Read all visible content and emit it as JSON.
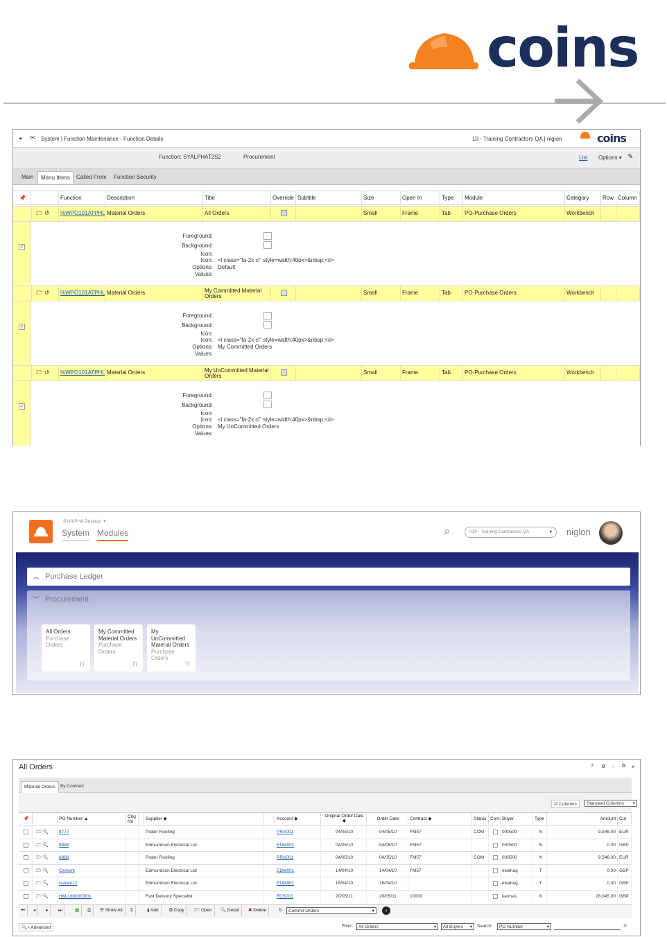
{
  "brand": {
    "name": "coins"
  },
  "p1": {
    "breadcrumb": "System | Function Maintenance - Function Details",
    "company": "10 - Training Contractors QA | niglon",
    "brand_small": "coins",
    "function_label": "Function: SYALPHAT2S2",
    "module_label": "Procurement",
    "list_link": "List",
    "options": "Options",
    "tabs": [
      "Main",
      "Menu Items",
      "Called From",
      "Function Security"
    ],
    "headers": [
      "Function",
      "Description",
      "Title",
      "Override",
      "Subtitle",
      "Size",
      "Open In",
      "Type",
      "Module",
      "Category",
      "Row",
      "Column"
    ],
    "rows": [
      {
        "function": "%WPO101ATPHL",
        "description": "Material Orders",
        "title": "All Orders",
        "size": "Small",
        "open_in": "Frame",
        "type": "Tab",
        "module": "PO-Purchase Orders",
        "category": "Workbench",
        "icon_line": "<i class=\"fa-2x cl\" style=width:40px>&nbsp;</i>",
        "options": "Default"
      },
      {
        "function": "%WPO101ATPHL",
        "description": "Material Orders",
        "title": "My Committed Material Orders",
        "size": "Small",
        "open_in": "Frame",
        "type": "Tab",
        "module": "PO-Purchase Orders",
        "category": "Workbench",
        "icon_line": "<i class=\"fa-2x cl\" style=width:40px>&nbsp;</i>",
        "options": "My Committed Orders"
      },
      {
        "function": "%WPO101ATPHL",
        "description": "Material Orders",
        "title": "My UnCommitted Material Orders",
        "size": "Small",
        "open_in": "Frame",
        "type": "Tab",
        "module": "PO-Purchase Orders",
        "category": "Workbench",
        "icon_line": "<i class=\"fa-2x cl\" style=width:40px>&nbsp;</i>",
        "options": "My UnCommitted Orders"
      }
    ],
    "detail_labels": [
      "Foreground:",
      "Background:",
      "Icon:",
      "Icon:",
      "Options:",
      "Values:"
    ]
  },
  "p2": {
    "desktop": "SYALPHA Desktop",
    "nav": [
      "System",
      "Modules"
    ],
    "company": "010 - Training Contractors QA",
    "user": "niglon",
    "sections": [
      "Purchase Ledger",
      "Procurement"
    ],
    "tiles": [
      {
        "title": "All Orders",
        "sub": "Purchase Orders"
      },
      {
        "title": "My Committed Material Orders",
        "sub": "Purchase Orders"
      },
      {
        "title": "My UnCommitted Material Orders",
        "sub": "Purchase Orders"
      }
    ]
  },
  "p3": {
    "title": "All Orders",
    "window_controls": [
      "?",
      "⚙",
      "–",
      "⧉",
      "×"
    ],
    "tabs": [
      "Material Orders",
      "By Contract"
    ],
    "columns_btn": "Columns",
    "columns_select": "Standard Columns",
    "headers": [
      "PO Number ▲",
      "Chg No",
      "Supplier ◆",
      "Account ◆",
      "Original Order Date ◆",
      "Order Date",
      "Contract ◆",
      "Status",
      "Com",
      "Buyer",
      "Type",
      "Amount",
      "Cur"
    ],
    "rows": [
      {
        "po": "8777",
        "supplier": "Prater Roofing",
        "account": "PRA001",
        "orig": "04/05/10",
        "date": "04/05/10",
        "contract": "FM57",
        "status": "COM",
        "buyer": "000500",
        "type": "N",
        "amount": "9,546.00",
        "cur": "EUR"
      },
      {
        "po": "8888",
        "supplier": "Edmundson Electrical Ltd",
        "account": "EDM001",
        "orig": "04/05/10",
        "date": "04/05/10",
        "contract": "FM57",
        "status": "",
        "buyer": "000500",
        "type": "N",
        "amount": "0.00",
        "cur": "GBP"
      },
      {
        "po": "8889",
        "supplier": "Prater Roofing",
        "account": "PRA001",
        "orig": "04/05/10",
        "date": "04/05/10",
        "contract": "FM57",
        "status": "COM",
        "buyer": "000500",
        "type": "N",
        "amount": "9,546.00",
        "cur": "EUR"
      },
      {
        "po": "Cement",
        "supplier": "Edmundson Electrical Ltd",
        "account": "EDM001",
        "orig": "14/04/10",
        "date": "14/04/10",
        "contract": "FM57",
        "status": "",
        "buyer": "ewahug",
        "type": "T",
        "amount": "0.00",
        "cur": "GBP"
      },
      {
        "po": "cement 2",
        "supplier": "Edmundson Electrical Ltd",
        "account": "EDM001",
        "orig": "16/04/10",
        "date": "16/04/10",
        "contract": "",
        "status": "",
        "buyer": "ewahug",
        "type": "T",
        "amount": "0.00",
        "cur": "GBP"
      },
      {
        "po": "HM-10000/0001",
        "supplier": "Fast Delivery Specialist",
        "account": "FDS001",
        "orig": "20/05/11",
        "date": "20/05/11",
        "contract": "10000",
        "status": "",
        "buyer": "karmas",
        "type": "N",
        "amount": "28,045.00",
        "cur": "GBP"
      }
    ],
    "toolbar": {
      "show_all": "Show All",
      "add": "Add",
      "copy": "Copy",
      "open": "Open",
      "detail": "Detail",
      "delete": "Delete",
      "commit": "Commit Orders"
    },
    "advanced": "Advanced",
    "filter_label": "Filter:",
    "filter_value": "All Orders",
    "buyers_value": "All Buyers",
    "search_label": "Search:",
    "search_value": "PO Number"
  }
}
